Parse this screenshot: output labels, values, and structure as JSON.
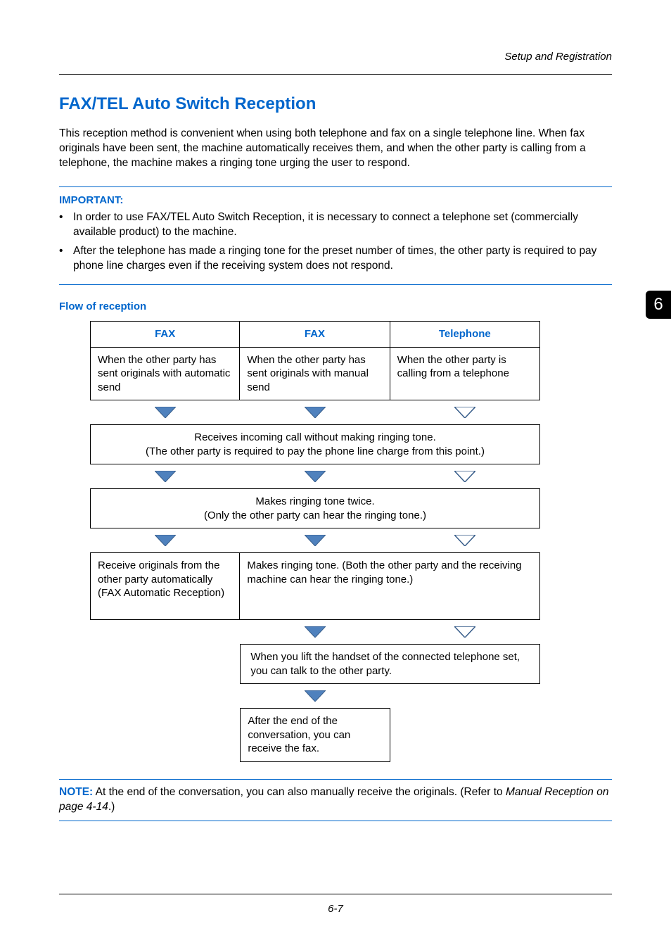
{
  "header": {
    "section": "Setup and Registration"
  },
  "title": "FAX/TEL Auto Switch Reception",
  "intro": "This reception method is convenient when using both telephone and fax on a single telephone line. When fax originals have been sent, the machine automatically receives them, and when the other party is calling from a telephone, the machine makes a ringing tone urging the user to respond.",
  "important": {
    "label": "IMPORTANT:",
    "items": [
      "In order to use FAX/TEL Auto Switch Reception, it is necessary to connect a telephone set (commercially available product) to the machine.",
      "After the telephone has made a ringing tone for the preset number of times, the other party is required to pay phone line charges even if the receiving system does not respond."
    ]
  },
  "flow": {
    "label": "Flow of reception",
    "headers": {
      "c1": "FAX",
      "c2": "FAX",
      "c3": "Telephone"
    },
    "row1": {
      "c1": "When the other party has sent originals with automatic send",
      "c2": "When the other party has sent originals with manual send",
      "c3": "When the other party is calling from a telephone"
    },
    "step_receive": "Receives incoming call without making ringing tone.\n(The other party is required to pay the phone line charge from this point.)",
    "step_ring_twice": "Makes ringing tone twice.\n(Only the other party can hear the ringing tone.)",
    "row3": {
      "c1": "Receive originals from the other party automatically (FAX Automatic Reception)",
      "c23": "Makes ringing tone. (Both the other party and the receiving machine can hear the ringing tone.)"
    },
    "step_handset": "When you lift the handset of the connected telephone set, you can talk to the other party.",
    "step_after": "After the end of the conversation, you can receive the fax."
  },
  "note": {
    "label": "NOTE:",
    "text_before": " At the end of the conversation, you can also manually receive the originals. (Refer to ",
    "ref": "Manual Reception on page 4-14",
    "text_after": ".)"
  },
  "page_number": "6-7",
  "side_tab": "6",
  "arrows": {
    "solid_fill": "#4f81bd",
    "solid_stroke": "#385d8a",
    "outline_stroke": "#385d8a"
  }
}
